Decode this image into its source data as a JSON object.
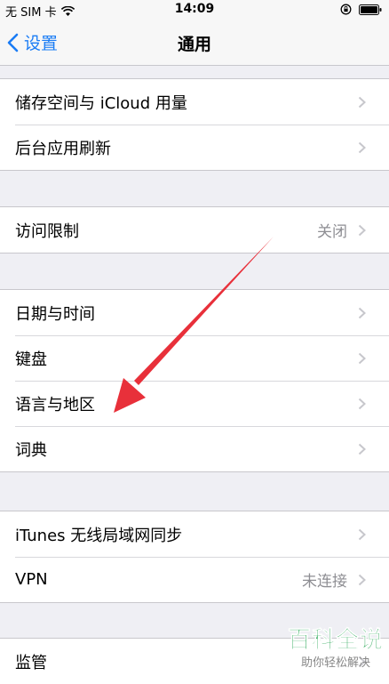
{
  "status_bar": {
    "carrier": "无 SIM 卡",
    "time": "14:09"
  },
  "nav": {
    "back_label": "设置",
    "title": "通用"
  },
  "groups": [
    {
      "rows": [
        {
          "label": "储存空间与 iCloud 用量",
          "value": ""
        },
        {
          "label": "后台应用刷新",
          "value": ""
        }
      ]
    },
    {
      "rows": [
        {
          "label": "访问限制",
          "value": "关闭"
        }
      ]
    },
    {
      "rows": [
        {
          "label": "日期与时间",
          "value": ""
        },
        {
          "label": "键盘",
          "value": ""
        },
        {
          "label": "语言与地区",
          "value": ""
        },
        {
          "label": "词典",
          "value": ""
        }
      ]
    },
    {
      "rows": [
        {
          "label": "iTunes 无线局域网同步",
          "value": ""
        },
        {
          "label": "VPN",
          "value": "未连接"
        }
      ]
    },
    {
      "rows": [
        {
          "label": "监管",
          "value": ""
        }
      ]
    }
  ],
  "watermark": {
    "title": "百科全说",
    "subtitle": "助你轻松解决"
  },
  "colors": {
    "accent": "#1a7cf5",
    "annotation_arrow": "#e8303a",
    "watermark": "#1aa14a"
  }
}
